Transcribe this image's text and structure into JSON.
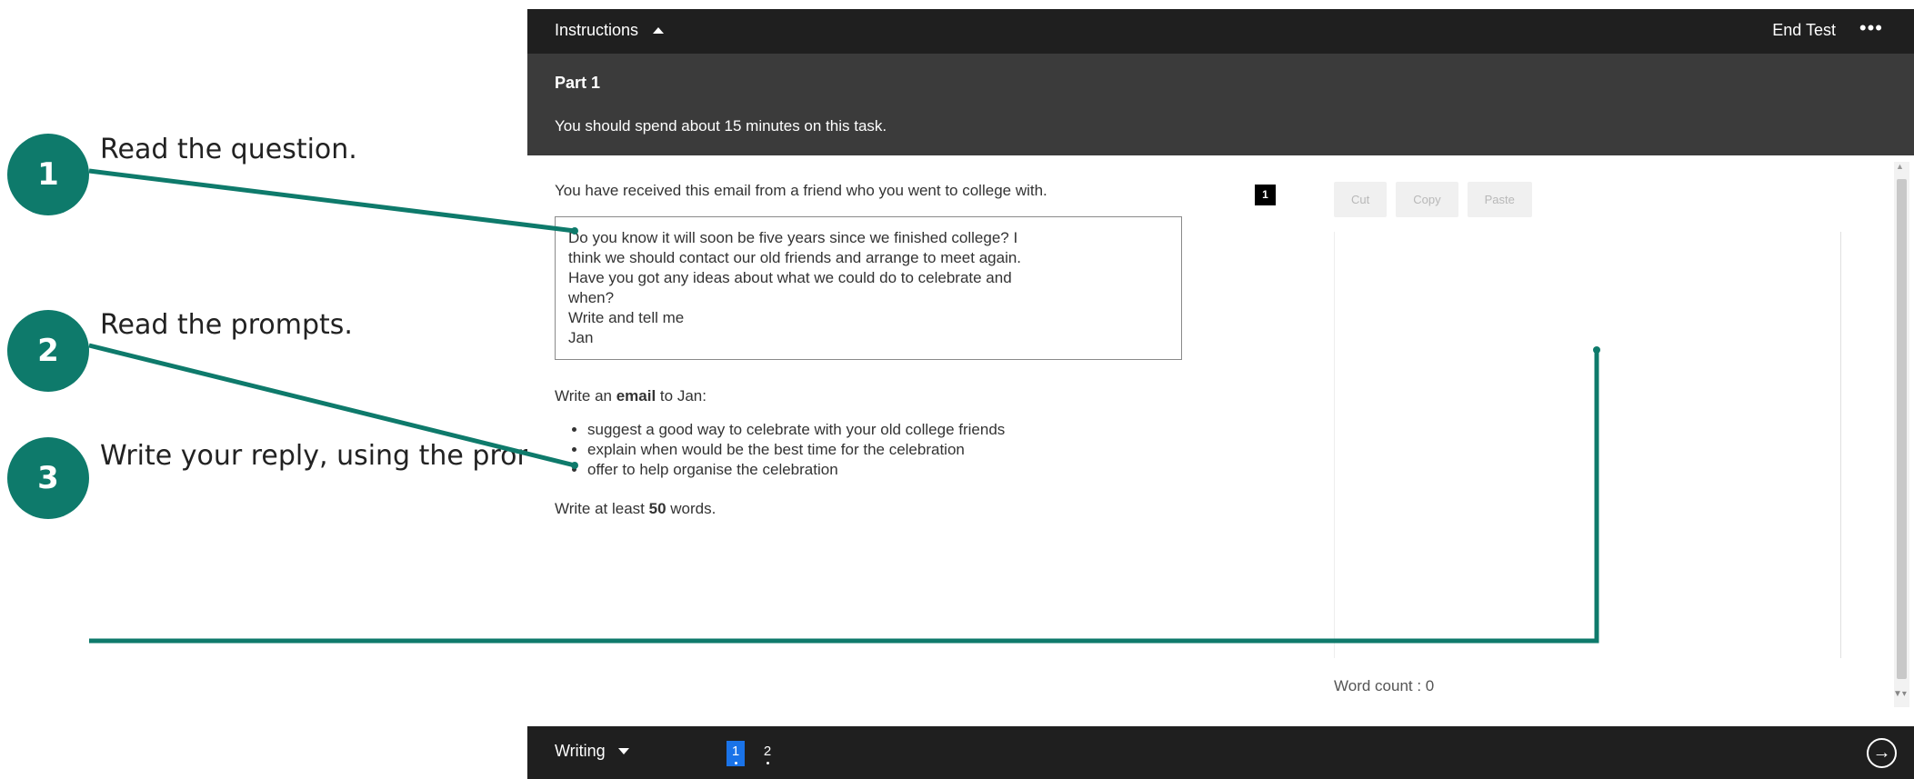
{
  "steps": [
    {
      "num": "1",
      "label": "Read the question."
    },
    {
      "num": "2",
      "label": "Read the prompts."
    },
    {
      "num": "3",
      "label": "Write your reply, using the prompts."
    }
  ],
  "header": {
    "instructions": "Instructions",
    "end_test": "End Test",
    "more": "•••"
  },
  "part": {
    "title": "Part 1",
    "subtitle": "You should spend about 15 minutes on this task."
  },
  "task": {
    "intro": "You have received this email from a friend who you went to college with.",
    "email_lines": [
      "Do you know it will soon be five years since we finished college? I",
      "think we should contact our old friends and arrange to meet again.",
      "Have you got any ideas about what we could do to celebrate and",
      "when?",
      "Write and tell me",
      "Jan"
    ],
    "write_pre": "Write an ",
    "write_bold": "email",
    "write_post": " to Jan:",
    "prompts": [
      "suggest a good way to celebrate with your old college friends",
      "explain when would be the best time for the celebration",
      "offer to help organise the celebration"
    ],
    "min_pre": "Write at least ",
    "min_bold": "50",
    "min_post": " words."
  },
  "editor": {
    "question_num": "1",
    "cut": "Cut",
    "copy": "Copy",
    "paste": "Paste",
    "word_count": "Word count : 0"
  },
  "footer": {
    "section": "Writing",
    "pages": [
      "1",
      "2"
    ],
    "next_glyph": "→"
  },
  "colors": {
    "accent": "#0e7a6b",
    "page_active": "#1a73e8",
    "bar_dark": "#1f1f1f",
    "bar_mid": "#3b3b3b"
  }
}
